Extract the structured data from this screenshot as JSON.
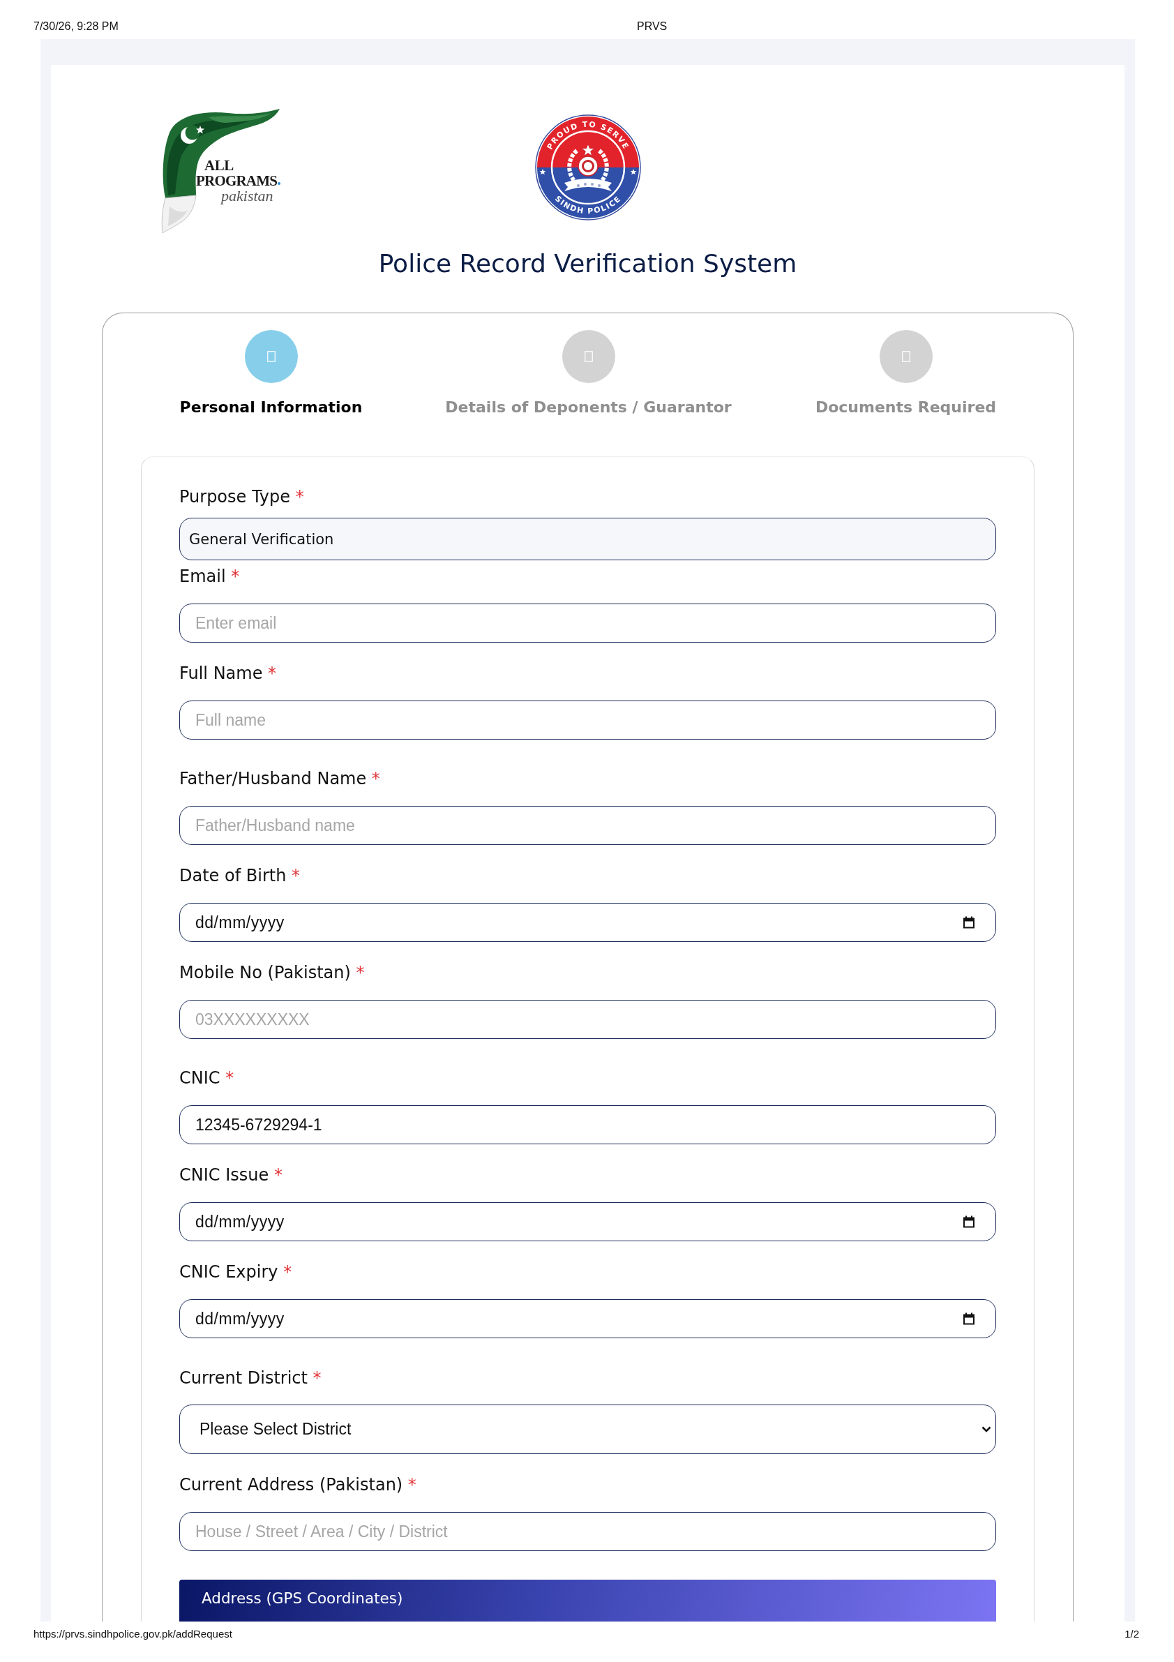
{
  "print_header": {
    "date_time": "7/30/26, 9:28 PM",
    "title": "PRVS"
  },
  "brand_logo": {
    "wordmark": [
      "ALL",
      "PROGRAMS",
      "pakistan"
    ]
  },
  "emblem": {
    "top_text": "PROUD TO SERVE",
    "bottom_text": "SINDH POLICE"
  },
  "page_title": "Police Record Verification System",
  "steps": [
    {
      "label": "Personal Information",
      "selected": true
    },
    {
      "label": "Details of Deponents / Guarantor",
      "selected": false
    },
    {
      "label": "Documents Required",
      "selected": false
    }
  ],
  "form": {
    "fields": [
      {
        "kind": "readonly",
        "label": "Purpose Type",
        "required_mark": "*",
        "value": "General Verification"
      },
      {
        "kind": "text",
        "label": "Email",
        "required_mark": "*",
        "placeholder": "Enter email"
      },
      {
        "kind": "text",
        "label": "Full Name",
        "required_mark": "*",
        "placeholder": "Full name"
      },
      {
        "kind": "text",
        "label": "Father/Husband Name",
        "required_mark": "*",
        "placeholder": "Father/Husband name"
      },
      {
        "kind": "date",
        "label": "Date of Birth",
        "required_mark": "*",
        "placeholder": "dd/mm/yyyy"
      },
      {
        "kind": "text",
        "label": "Mobile No (Pakistan)",
        "required_mark": "*",
        "placeholder": "03XXXXXXXXX"
      },
      {
        "kind": "text",
        "label": "CNIC",
        "required_mark": "*",
        "value": "12345-6729294-1"
      },
      {
        "kind": "date",
        "label": "CNIC Issue",
        "required_mark": "*",
        "placeholder": "dd/mm/yyyy"
      },
      {
        "kind": "date",
        "label": "CNIC Expiry",
        "required_mark": "*",
        "placeholder": "dd/mm/yyyy"
      },
      {
        "kind": "select",
        "label": "Current District",
        "required_mark": "*",
        "value": "Please Select District"
      },
      {
        "kind": "text",
        "label": "Current Address (Pakistan)",
        "required_mark": "*",
        "placeholder": "House / Street / Area / City / District"
      }
    ],
    "section_header": "Address (GPS Coordinates)"
  },
  "print_footer": {
    "url": "https://prvs.sindhpolice.gov.pk/addRequest",
    "page": "1/2"
  }
}
